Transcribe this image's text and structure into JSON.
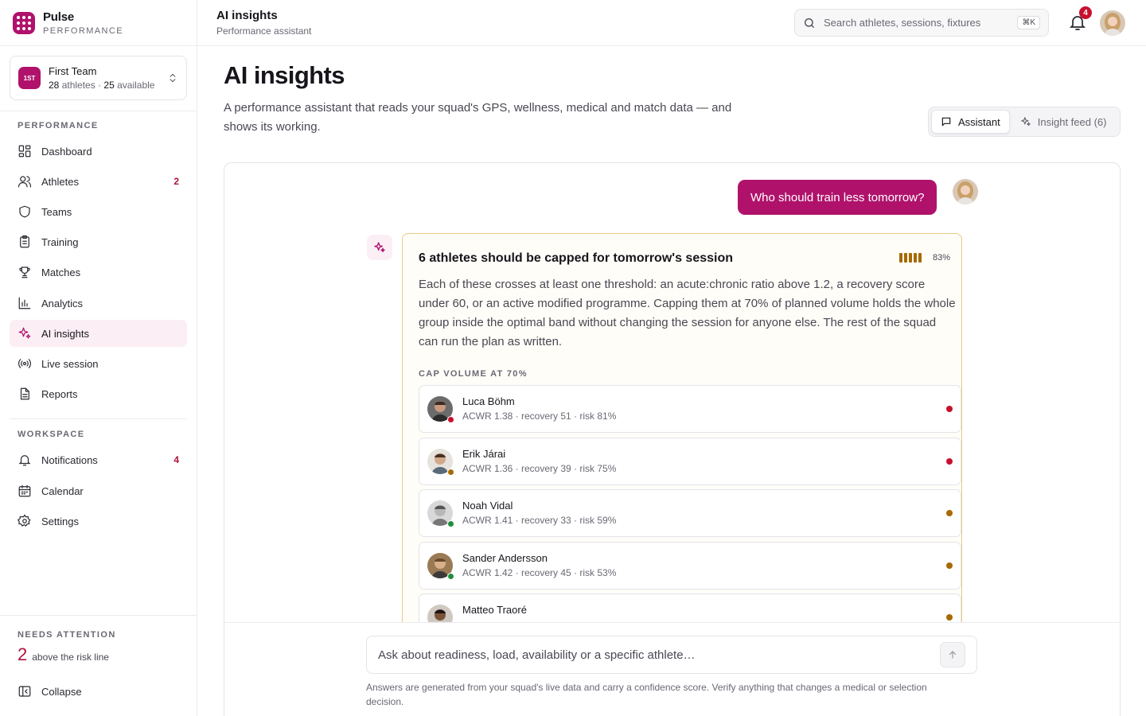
{
  "brand": {
    "name": "Pulse",
    "subtitle": "PERFORMANCE"
  },
  "team": {
    "badge": "1ST",
    "name": "First Team",
    "athletes": "28",
    "athletes_label": "athletes",
    "sep": " · ",
    "available": "25",
    "available_label": "available"
  },
  "sidebar": {
    "performance_title": "PERFORMANCE",
    "items": [
      {
        "label": "Dashboard"
      },
      {
        "label": "Athletes",
        "count": "2"
      },
      {
        "label": "Teams"
      },
      {
        "label": "Training"
      },
      {
        "label": "Matches"
      },
      {
        "label": "Analytics"
      },
      {
        "label": "AI insights"
      },
      {
        "label": "Live session"
      },
      {
        "label": "Reports"
      }
    ],
    "workspace_title": "WORKSPACE",
    "workspace_items": [
      {
        "label": "Notifications",
        "count": "4"
      },
      {
        "label": "Calendar"
      },
      {
        "label": "Settings"
      }
    ],
    "needs_title": "NEEDS ATTENTION",
    "needs_count": "2",
    "needs_label": "above the risk line",
    "collapse_label": "Collapse"
  },
  "topbar": {
    "title": "AI insights",
    "subtitle": "Performance assistant",
    "search_placeholder": "Search athletes, sessions, fixtures",
    "search_shortcut": "⌘K",
    "notification_count": "4"
  },
  "page": {
    "title": "AI insights",
    "description": "A performance assistant that reads your squad's GPS, wellness, medical and match data — and shows its working.",
    "tabs": [
      {
        "label": "Assistant"
      },
      {
        "label": "Insight feed (6)"
      }
    ]
  },
  "chat": {
    "user_message": "Who should train less tomorrow?",
    "answer": {
      "title": "6 athletes should be capped for tomorrow's session",
      "confidence": "83%",
      "body": "Each of these crosses at least one threshold: an acute:chronic ratio above 1.2, a recovery score under 60, or an active modified programme. Capping them at 70% of planned volume holds the whole group inside the optimal band without changing the session for anyone else. The rest of the squad can run the plan as written.",
      "section_title": "CAP VOLUME AT 70%",
      "athletes": [
        {
          "name": "Luca Böhm",
          "meta": "ACWR 1.38 · recovery 51 · risk 81%",
          "status_color": "#c8102e",
          "risk_color": "#c8102e"
        },
        {
          "name": "Erik Járai",
          "meta": "ACWR 1.36 · recovery 39 · risk 75%",
          "status_color": "#a66a00",
          "risk_color": "#c8102e"
        },
        {
          "name": "Noah Vidal",
          "meta": "ACWR 1.41 · recovery 33 · risk 59%",
          "status_color": "#1e8e3e",
          "risk_color": "#a66a00"
        },
        {
          "name": "Sander Andersson",
          "meta": "ACWR 1.42 · recovery 45 · risk 53%",
          "status_color": "#1e8e3e",
          "risk_color": "#a66a00"
        },
        {
          "name": "Matteo Traoré",
          "meta": "",
          "status_color": "#1e8e3e",
          "risk_color": "#a66a00"
        }
      ]
    },
    "composer_placeholder": "Ask about readiness, load, availability or a specific athlete…",
    "disclaimer": "Answers are generated from your squad's live data and carry a confidence score. Verify anything that changes a medical or selection decision."
  },
  "colors": {
    "accent": "#b0126b",
    "danger": "#c8102e",
    "warning": "#a66a00",
    "success": "#1e8e3e"
  }
}
